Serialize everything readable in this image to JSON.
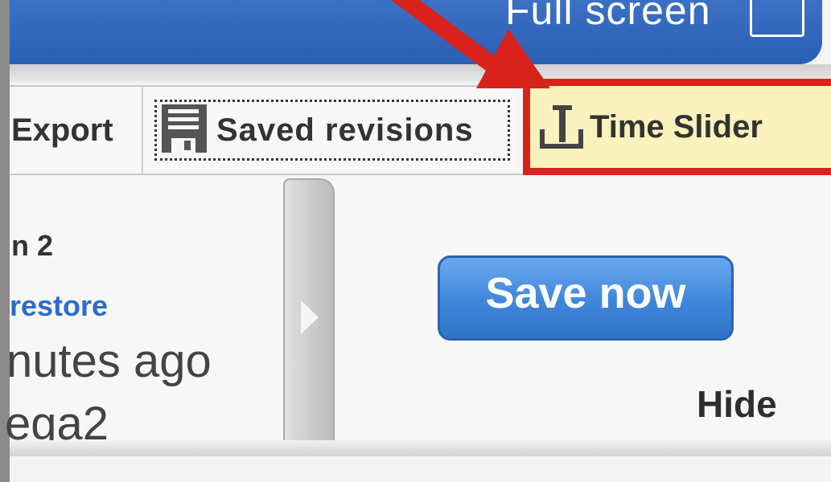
{
  "header": {
    "fullscreen_label": "Full screen",
    "fullscreen_checked": false
  },
  "toolbar": {
    "export_label": "Export",
    "saved_revisions_label": "Saved revisions",
    "time_slider_label": "Time Slider"
  },
  "revision": {
    "title": "n 2",
    "restore_label": "restore",
    "time": "nutes ago",
    "author": "ega2"
  },
  "actions": {
    "save_now_label": "Save now",
    "hide_label": "Hide"
  },
  "colors": {
    "header_blue": "#2f63b6",
    "highlight_red": "#d9221c",
    "highlight_fill": "#fbf1bc",
    "link_blue": "#2a6ccc",
    "button_blue": "#3f86da"
  },
  "icons": {
    "saved_revisions": "floppy-disk-icon",
    "time_slider": "time-slider-icon",
    "collapse": "chevron-right-icon",
    "annotation": "red-arrow-icon"
  }
}
